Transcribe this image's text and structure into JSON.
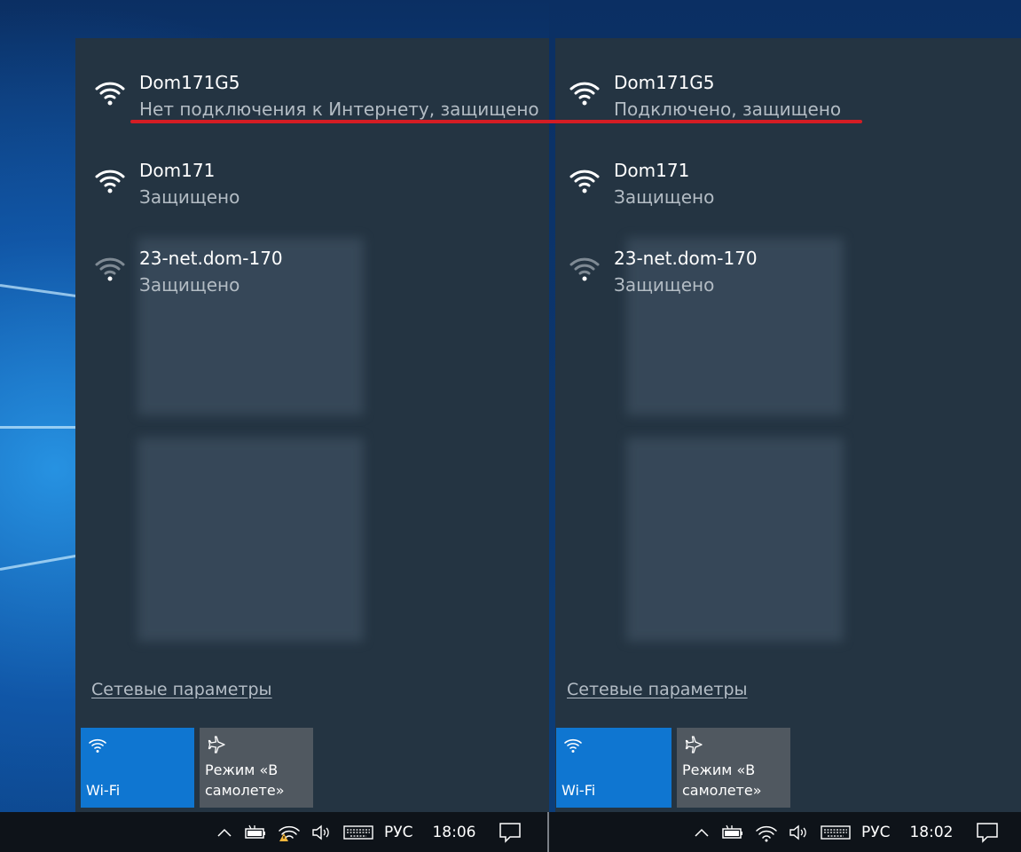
{
  "left_panel": {
    "networks": [
      {
        "ssid": "Dom171G5",
        "status": "Нет подключения к Интернету, защищено",
        "signal": "full"
      },
      {
        "ssid": "Dom171",
        "status": "Защищено",
        "signal": "full"
      },
      {
        "ssid": "23-net.dom-170",
        "status": "Защищено",
        "signal": "weak"
      }
    ],
    "settings_link": "Сетевые параметры",
    "tiles": {
      "wifi": "Wi-Fi",
      "airplane_line1": "Режим «В",
      "airplane_line2": "самолете»"
    },
    "taskbar": {
      "language": "РУС",
      "time": "18:06",
      "network_icon": "wifi-warning-icon"
    }
  },
  "right_panel": {
    "networks": [
      {
        "ssid": "Dom171G5",
        "status": "Подключено, защищено",
        "signal": "full"
      },
      {
        "ssid": "Dom171",
        "status": "Защищено",
        "signal": "full"
      },
      {
        "ssid": "23-net.dom-170",
        "status": "Защищено",
        "signal": "weak"
      }
    ],
    "settings_link": "Сетевые параметры",
    "tiles": {
      "wifi": "Wi-Fi",
      "airplane_line1": "Режим «В",
      "airplane_line2": "самолете»"
    },
    "taskbar": {
      "language": "РУС",
      "time": "18:02",
      "network_icon": "wifi-icon"
    }
  },
  "colors": {
    "accent": "#0f76d1",
    "highlight_line": "#d41d24",
    "flyout_bg": "#243442",
    "taskbar_bg": "#0e1319"
  }
}
